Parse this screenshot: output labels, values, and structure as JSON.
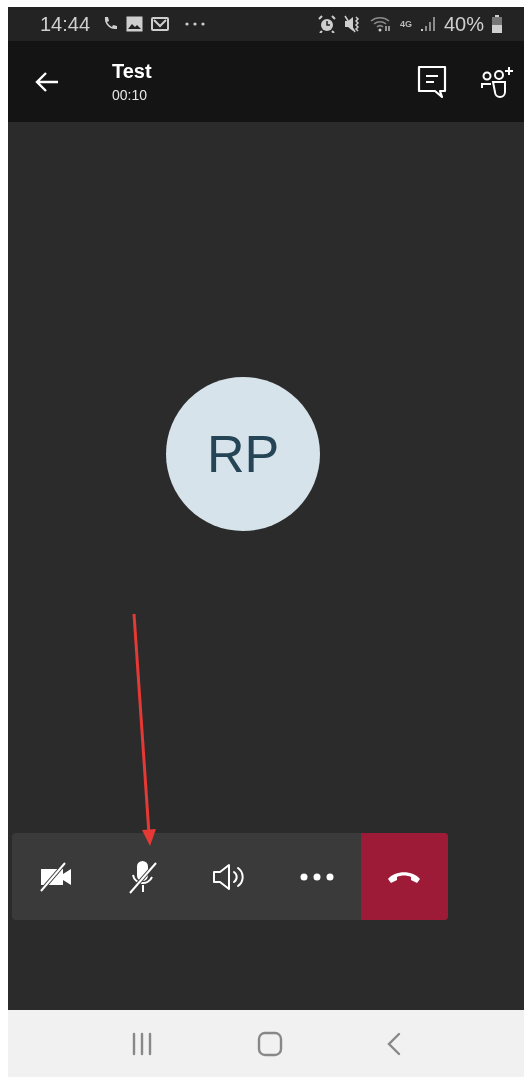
{
  "status_bar": {
    "time": "14:44",
    "network": "4G",
    "battery": "40%"
  },
  "header": {
    "title": "Test",
    "duration": "00:10"
  },
  "avatar": {
    "initials": "RP"
  },
  "controls": [
    {
      "kind": "camera-off"
    },
    {
      "kind": "mic-off"
    },
    {
      "kind": "speaker"
    },
    {
      "kind": "more"
    },
    {
      "kind": "hang-up"
    }
  ]
}
